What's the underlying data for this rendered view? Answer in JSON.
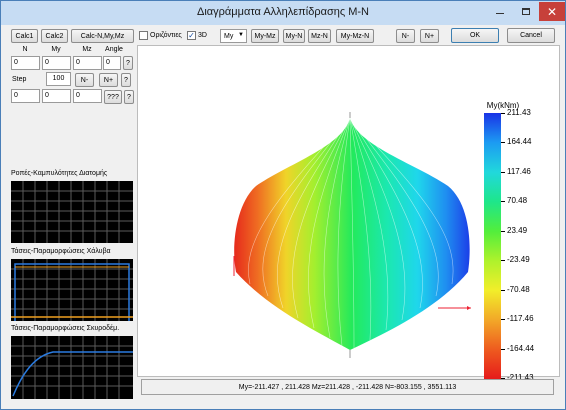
{
  "window": {
    "title": "Διαγράμματα Αλληλεπίδρασης M-N"
  },
  "toolbar": {
    "calc1": "Calc1",
    "calc2": "Calc2",
    "calc_all": "Calc-N,My,Mz",
    "horizontals_label": "Οριζόντιες",
    "horizontals_checked": false,
    "three_d_label": "3D",
    "three_d_checked": true,
    "axis_select": "My",
    "view_buttons": [
      "My-Mz",
      "My-N",
      "Mz-N",
      "My-Mz-N"
    ],
    "n_minus": "N-",
    "n_plus": "N+",
    "ok": "OK",
    "cancel": "Cancel"
  },
  "inputs": {
    "headers": [
      "N",
      "My",
      "Mz",
      "Angle"
    ],
    "values": [
      "0",
      "0",
      "0",
      "0"
    ],
    "help": "?",
    "step_label": "Step",
    "step_value": "100",
    "step_minus": "N-",
    "step_plus": "N+",
    "step_help": "?",
    "out_values": [
      "0",
      "0",
      "0"
    ],
    "unknown": "???",
    "unknown_help": "?"
  },
  "panels": {
    "moment_curvature": "Ροπές-Καμπυλότητες Διατομής",
    "steel_stress_strain": "Τάσεις-Παραμορφώσεις Χάλυβα",
    "concrete_stress_strain": "Τάσεις-Παραμορφώσεις Σκυροδέμ."
  },
  "colorbar": {
    "title": "My(kNm)",
    "ticks": [
      "211.43",
      "164.44",
      "117.46",
      "70.48",
      "23.49",
      "-23.49",
      "-70.48",
      "-117.46",
      "-164.44",
      "-211.43"
    ],
    "colors": [
      "#1a33e6",
      "#1c9bf2",
      "#21d8dc",
      "#1ee68a",
      "#52ee3c",
      "#aef22c",
      "#f2ee2a",
      "#f2a828",
      "#ee5b1f",
      "#e61b1b"
    ]
  },
  "status_text": "My=-211.427 , 211.428 Mz=211.428 , -211.428 N=-803.155 , 3551.113"
}
